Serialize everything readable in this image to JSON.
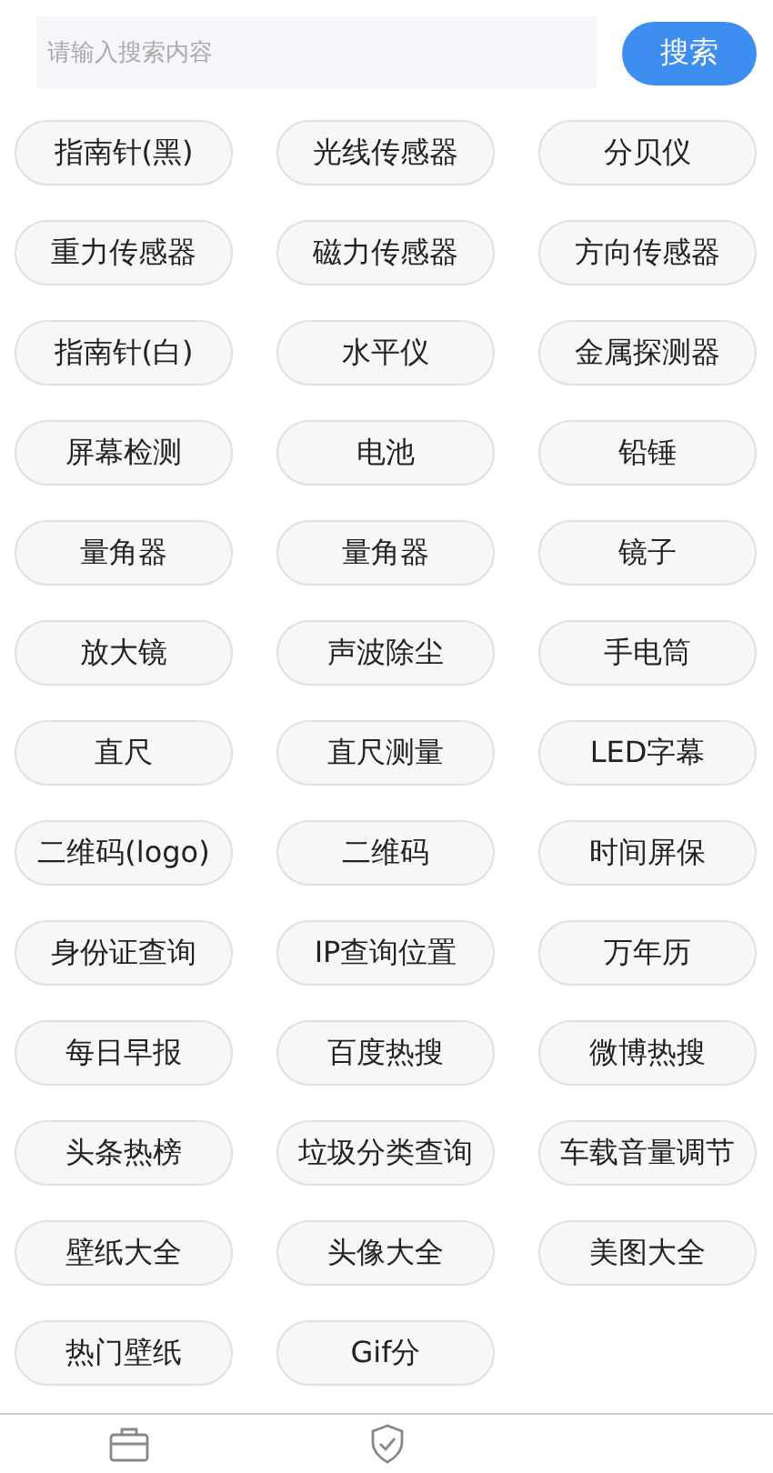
{
  "search": {
    "placeholder": "请输入搜索内容",
    "button": "搜索"
  },
  "tools": [
    "指南针(黑)",
    "光线传感器",
    "分贝仪",
    "重力传感器",
    "磁力传感器",
    "方向传感器",
    "指南针(白)",
    "水平仪",
    "金属探测器",
    "屏幕检测",
    "电池",
    "铅锤",
    "量角器",
    "量角器",
    "镜子",
    "放大镜",
    "声波除尘",
    "手电筒",
    "直尺",
    "直尺测量",
    "LED字幕",
    "二维码(logo)",
    "二维码",
    "时间屏保",
    "身份证查询",
    "IP查询位置",
    "万年历",
    "每日早报",
    "百度热搜",
    "微博热搜",
    "头条热榜",
    "垃圾分类查询",
    "车载音量调节",
    "壁纸大全",
    "头像大全",
    "美图大全",
    "热门壁纸",
    "Gif分"
  ],
  "nav": [
    {
      "kind": "briefcase",
      "selected": false
    },
    {
      "kind": "shield",
      "selected": false
    }
  ]
}
